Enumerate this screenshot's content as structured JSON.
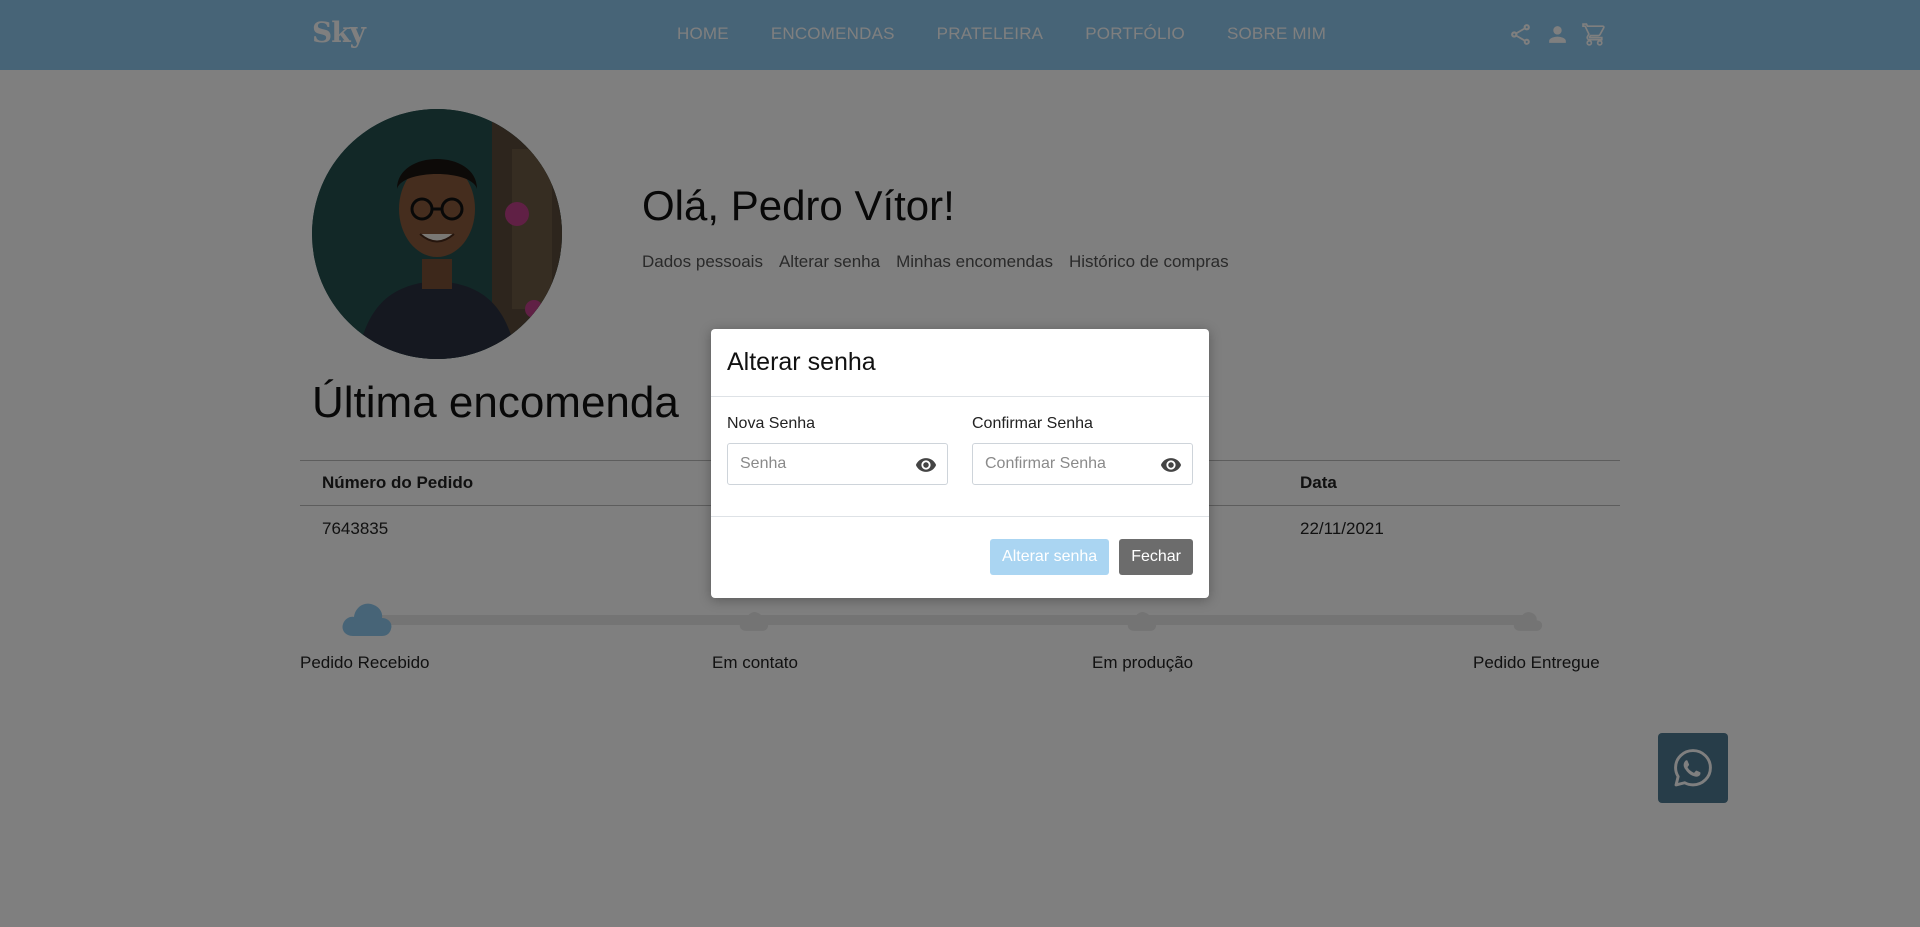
{
  "nav": {
    "logo": "Sky",
    "links": [
      "HOME",
      "ENCOMENDAS",
      "PRATELEIRA",
      "PORTFÓLIO",
      "SOBRE MIM"
    ],
    "icons": [
      "share-icon",
      "user-icon",
      "cart-icon"
    ]
  },
  "profile": {
    "greeting": "Olá, Pedro Vítor!",
    "tabs": [
      "Dados pessoais",
      "Alterar senha",
      "Minhas encomendas",
      "Histórico de compras"
    ]
  },
  "order": {
    "section_title": "Última encomenda",
    "columns": [
      "Número do Pedido",
      "Data"
    ],
    "rows": [
      {
        "number": "7643835",
        "date": "22/11/2021"
      }
    ]
  },
  "progress": {
    "steps": [
      "Pedido Recebido",
      "Em contato",
      "Em produção",
      "Pedido Entregue"
    ],
    "current_step": 1,
    "fraction_complete": 0
  },
  "whatsapp": {
    "icon": "whatsapp-icon"
  },
  "modal": {
    "title": "Alterar senha",
    "new_password": {
      "label": "Nova Senha",
      "placeholder": "Senha",
      "value": ""
    },
    "confirm_password": {
      "label": "Confirmar Senha",
      "placeholder": "Confirmar Senha",
      "value": ""
    },
    "submit_label": "Alterar senha",
    "close_label": "Fechar"
  },
  "colors": {
    "brand": "#8ec8ee",
    "whatsapp_bg": "#4f7b92",
    "close_button": "#6c6c6c",
    "overlay": "rgba(0,0,0,0.5)"
  }
}
